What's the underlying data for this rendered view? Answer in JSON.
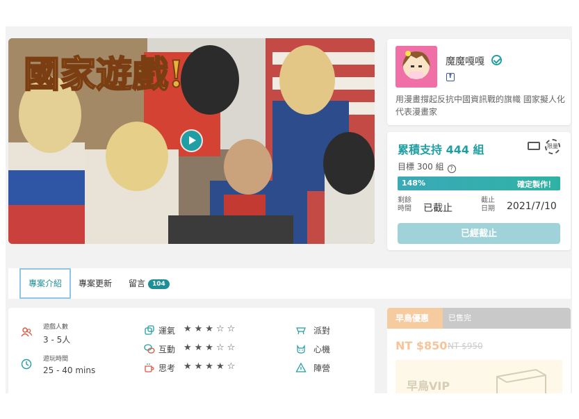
{
  "video": {
    "title_art": "國家遊戲!",
    "play_icon": "play-icon"
  },
  "creator": {
    "name": "魔魔嘎嘎",
    "verified_icon": "verified-check-icon",
    "facebook_icon": "facebook-icon",
    "facebook_glyph": "f",
    "description": "用漫畫撐起反抗中國資訊戰的旗幟 國家擬人化代表漫畫家"
  },
  "funding": {
    "raised": "累積支持 444 組",
    "goal": "目標 300 組",
    "help_glyph": "?",
    "progress_percent": 148,
    "progress_label": "148%",
    "status": "確定製作！",
    "remaining_label": "剩餘時間",
    "remaining_value": "已截止",
    "end_label": "截止日期",
    "end_value": "2021/7/10",
    "closed_button": "已經截止",
    "limited_badge": "限量",
    "icons": [
      "shipping-truck-icon",
      "limited-badge-icon"
    ]
  },
  "tabs": [
    {
      "label": "專案介紹",
      "active": true
    },
    {
      "label": "專案更新",
      "active": false
    },
    {
      "label": "留言",
      "count": "104",
      "active": false
    }
  ],
  "game_info": {
    "players_label": "遊戲人數",
    "players_value": "3 - 5人",
    "time_label": "遊玩時間",
    "time_value": "25 - 40 mins",
    "attributes": [
      {
        "label": "運氣",
        "stars": "★★★☆☆"
      },
      {
        "label": "互動",
        "stars": "★★★☆☆"
      },
      {
        "label": "思考",
        "stars": "★★★★☆"
      }
    ],
    "tags": [
      "派對",
      "心機",
      "陣營"
    ]
  },
  "reward": {
    "tag": "早鳥優惠",
    "sold_out": "已售完",
    "price": "NT $850",
    "original_price": "NT $950",
    "item_title": "早鳥VIP"
  }
}
